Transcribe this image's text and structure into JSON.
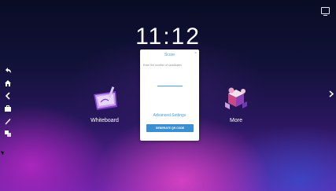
{
  "desktop": {
    "clock": "11:12",
    "apps": [
      {
        "label": "Whiteboard"
      },
      {
        "label": ""
      },
      {
        "label": "More"
      }
    ]
  },
  "dialog": {
    "title": "Score",
    "close_glyph": "×",
    "prompt": "Enter the number of candidates",
    "input_value": "",
    "advanced_link": "Advanced Settings",
    "generate_button": "GENERATE QR CODE"
  },
  "toolbar": {
    "icons": [
      "back-icon",
      "home-icon",
      "chevron-left-icon",
      "briefcase-icon",
      "pen-icon",
      "windows-icon"
    ]
  },
  "colors": {
    "accent": "#4a9ed9",
    "button": "#3b8fd0",
    "bg_dark": "#0b0e26",
    "bg_purple": "#6a23a8"
  }
}
